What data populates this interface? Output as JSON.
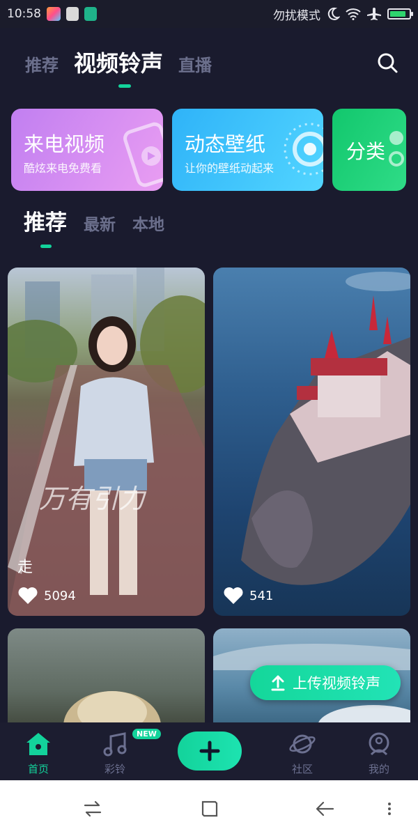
{
  "status_bar": {
    "time": "10:58",
    "dnd_label": "勿扰模式",
    "icons": [
      "app-flower-icon",
      "brush-icon",
      "usb-icon",
      "moon-icon",
      "wifi-icon",
      "airplane-icon",
      "battery-icon"
    ],
    "battery_level": 0.85
  },
  "top_tabs": [
    {
      "label": "推荐",
      "active": false
    },
    {
      "label": "视频铃声",
      "active": true
    },
    {
      "label": "直播",
      "active": false
    }
  ],
  "feature_cards": [
    {
      "title": "来电视频",
      "subtitle": "酷炫来电免费看",
      "color": "#c17ff1"
    },
    {
      "title": "动态壁纸",
      "subtitle": "让你的壁纸动起来",
      "color": "#2fb3f8"
    },
    {
      "title": "分类",
      "subtitle": "",
      "color": "#12c76d"
    }
  ],
  "sub_tabs": [
    {
      "label": "推荐",
      "active": true
    },
    {
      "label": "最新",
      "active": false
    },
    {
      "label": "本地",
      "active": false
    }
  ],
  "videos": [
    {
      "title": "走",
      "likes": "5094"
    },
    {
      "title": "",
      "likes": "541"
    }
  ],
  "upload_button": {
    "label": "上传视频铃声"
  },
  "bottom_nav": {
    "items": [
      {
        "label": "首页",
        "icon": "home-icon",
        "active": true
      },
      {
        "label": "彩铃",
        "icon": "music-note-icon",
        "active": false,
        "badge": "NEW"
      },
      {
        "label": "社区",
        "icon": "planet-icon",
        "active": false
      },
      {
        "label": "我的",
        "icon": "person-icon",
        "active": false
      }
    ],
    "add_icon": "plus-icon"
  },
  "colors": {
    "accent": "#13d39b",
    "background": "#1a1b2e",
    "inactive_text": "#6b6f8c"
  }
}
